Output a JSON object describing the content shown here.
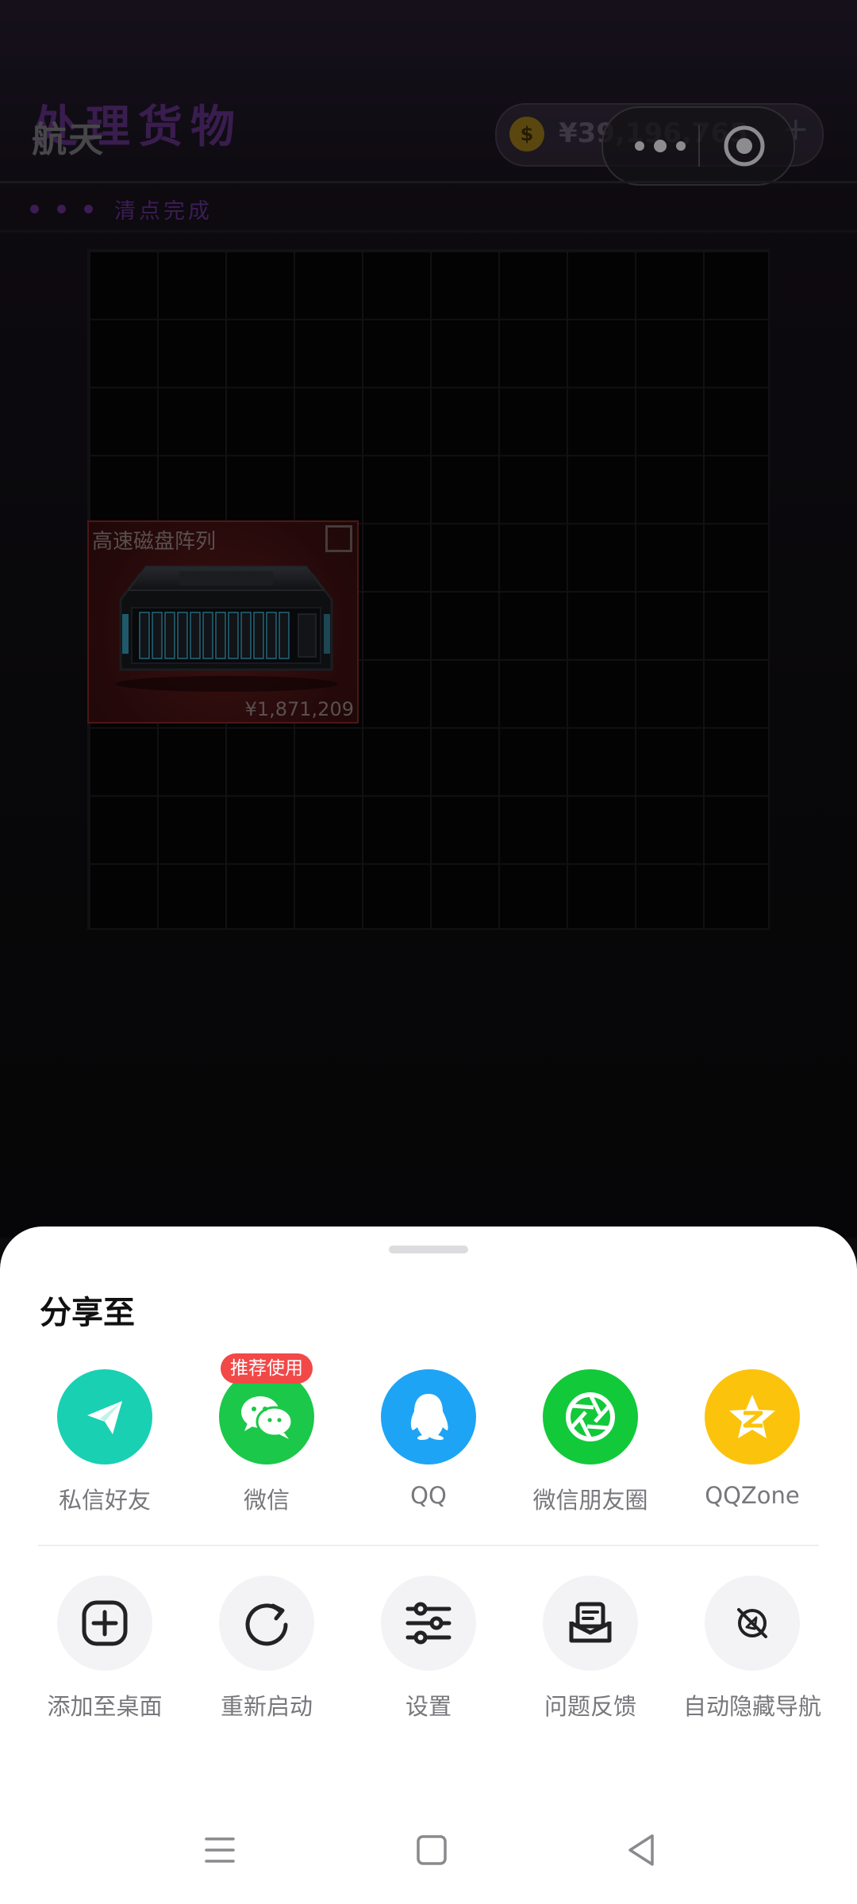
{
  "header": {
    "title": "处理货物",
    "app_name": "航天",
    "balance": "¥39,196,765",
    "plus": "+",
    "coin_symbol": "$"
  },
  "progress": {
    "label": "清点完成"
  },
  "item": {
    "name": "高速磁盘阵列",
    "price": "¥1,871,209"
  },
  "share_sheet": {
    "title": "分享至",
    "badge": "推荐使用",
    "share_options": [
      {
        "label": "私信好友",
        "icon": "paper-plane-icon",
        "color": "#19d0b3"
      },
      {
        "label": "微信",
        "icon": "wechat-icon",
        "color": "#1bc84a"
      },
      {
        "label": "QQ",
        "icon": "qq-penguin-icon",
        "color": "#1ea4f4"
      },
      {
        "label": "微信朋友圈",
        "icon": "moments-shutter-icon",
        "color": "#12c93a"
      },
      {
        "label": "QQZone",
        "icon": "qzone-star-icon",
        "color": "#fcc30d"
      }
    ],
    "actions": [
      {
        "label": "添加至桌面",
        "icon": "add-to-desktop-icon"
      },
      {
        "label": "重新启动",
        "icon": "restart-icon"
      },
      {
        "label": "设置",
        "icon": "settings-sliders-icon"
      },
      {
        "label": "问题反馈",
        "icon": "feedback-icon"
      },
      {
        "label": "自动隐藏导航",
        "icon": "auto-hide-nav-icon"
      }
    ]
  },
  "navbar": {
    "icons": [
      "menu-icon",
      "home-icon",
      "back-icon"
    ]
  }
}
